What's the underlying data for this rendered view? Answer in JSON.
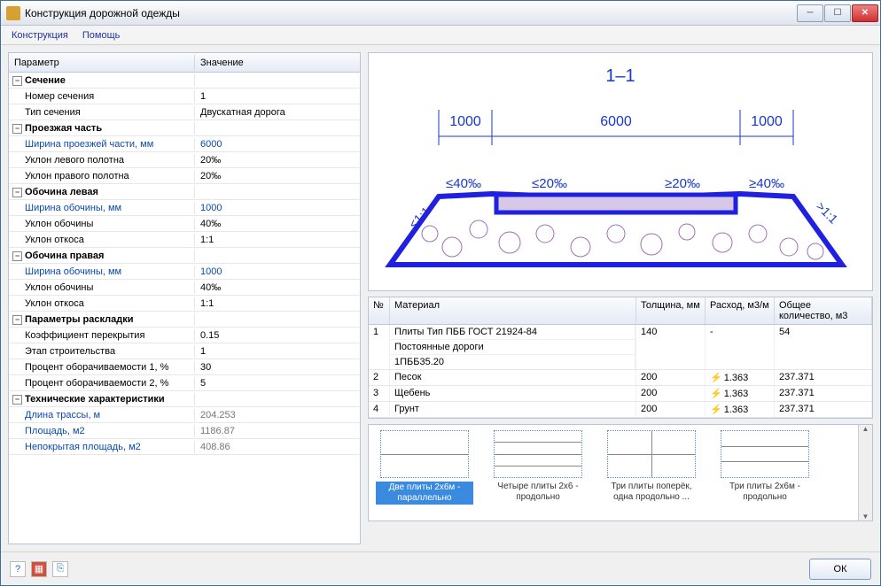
{
  "window": {
    "title": "Конструкция дорожной одежды"
  },
  "menu": {
    "construction": "Конструкция",
    "help": "Помощь"
  },
  "paramHead": {
    "c1": "Параметр",
    "c2": "Значение"
  },
  "groups": {
    "section": "Сечение",
    "roadway": "Проезжая часть",
    "shoulderL": "Обочина левая",
    "shoulderR": "Обочина правая",
    "layout": "Параметры раскладки",
    "tech": "Технические характеристики"
  },
  "rows": {
    "secNum": {
      "p": "Номер сечения",
      "v": "1"
    },
    "secType": {
      "p": "Тип сечения",
      "v": "Двускатная дорога"
    },
    "rwWidth": {
      "p": "Ширина проезжей части, мм",
      "v": "6000"
    },
    "rwSlopeL": {
      "p": "Уклон левого полотна",
      "v": "20‰"
    },
    "rwSlopeR": {
      "p": "Уклон правого полотна",
      "v": "20‰"
    },
    "shLW": {
      "p": "Ширина обочины, мм",
      "v": "1000"
    },
    "shLS": {
      "p": "Уклон обочины",
      "v": "40‰"
    },
    "shLSl": {
      "p": "Уклон откоса",
      "v": "1:1"
    },
    "shRW": {
      "p": "Ширина обочины, мм",
      "v": "1000"
    },
    "shRS": {
      "p": "Уклон обочины",
      "v": "40‰"
    },
    "shRSl": {
      "p": "Уклон откоса",
      "v": "1:1"
    },
    "coef": {
      "p": "Коэффициент перекрытия",
      "v": "0.15"
    },
    "stage": {
      "p": "Этап строительства",
      "v": "1"
    },
    "pct1": {
      "p": "Процент оборачиваемости 1, %",
      "v": "30"
    },
    "pct2": {
      "p": "Процент оборачиваемости 2, %",
      "v": "5"
    },
    "len": {
      "p": "Длина трассы, м",
      "v": "204.253"
    },
    "area": {
      "p": "Площадь, м2",
      "v": "1186.87"
    },
    "uncov": {
      "p": "Непокрытая площадь, м2",
      "v": "408.86"
    }
  },
  "diagram": {
    "title": "1–1",
    "d1": "1000",
    "d2": "6000",
    "d3": "1000",
    "s40l": "≤40‰",
    "s20l": "≤20‰",
    "s20r": "≥20‰",
    "s40r": "≥40‰",
    "slopeL": "<1:1",
    "slopeR": ">1:1"
  },
  "matHead": {
    "n": "№",
    "m": "Материал",
    "t": "Толщина, мм",
    "r": "Расход, м3/м",
    "q": "Общее количество, м3"
  },
  "materials": [
    {
      "n": "1",
      "m1": "Плиты Тип ПББ ГОСТ 21924-84",
      "m2": "Постоянные дороги",
      "m3": "1ПББ35.20",
      "t": "140",
      "r": "-",
      "q": "54"
    },
    {
      "n": "2",
      "m": "Песок",
      "t": "200",
      "r": "1.363",
      "q": "237.371",
      "bolt": true
    },
    {
      "n": "3",
      "m": "Щебень",
      "t": "200",
      "r": "1.363",
      "q": "237.371",
      "bolt": true
    },
    {
      "n": "4",
      "m": "Грунт",
      "t": "200",
      "r": "1.363",
      "q": "237.371",
      "bolt": true
    }
  ],
  "thumbs": {
    "t1": "Две плиты 2х6м - параллельно",
    "t2": "Четыре плиты 2х6 - продольно",
    "t3": "Три плиты поперёк, одна продольно ...",
    "t4": "Три плиты 2х6м - продольно"
  },
  "buttons": {
    "ok": "ОК"
  },
  "chart_data": {
    "type": "diagram",
    "title": "1–1",
    "dimensions_mm": {
      "left_shoulder": 1000,
      "roadway": 6000,
      "right_shoulder": 1000
    },
    "slopes": {
      "left_shoulder": "40‰",
      "left_lane": "20‰",
      "right_lane": "20‰",
      "right_shoulder": "40‰",
      "left_cut": "1:1",
      "right_cut": "1:1"
    }
  }
}
